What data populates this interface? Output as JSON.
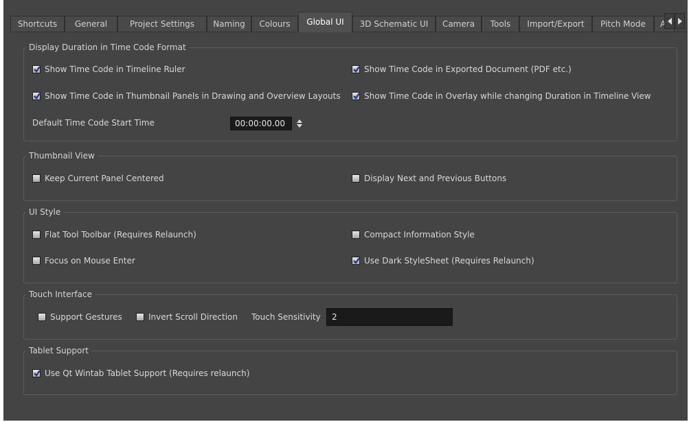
{
  "tabs": [
    {
      "label": "Shortcuts",
      "active": false
    },
    {
      "label": "General",
      "active": false
    },
    {
      "label": "Project Settings",
      "active": false
    },
    {
      "label": "Naming",
      "active": false
    },
    {
      "label": "Colours",
      "active": false
    },
    {
      "label": "Global UI",
      "active": true
    },
    {
      "label": "3D Schematic UI",
      "active": false
    },
    {
      "label": "Camera",
      "active": false
    },
    {
      "label": "Tools",
      "active": false
    },
    {
      "label": "Import/Export",
      "active": false
    },
    {
      "label": "Pitch Mode",
      "active": false
    },
    {
      "label": "Ad",
      "active": false
    }
  ],
  "tab_scroll": {
    "left_icon": "arrow-left-icon",
    "right_icon": "arrow-right-icon"
  },
  "timecode_group": {
    "title": "Display Duration in Time Code Format",
    "timeline_ruler": {
      "label": "Show Time Code in Timeline Ruler",
      "checked": true
    },
    "exported_document": {
      "label": "Show Time Code in Exported Document (PDF etc.)",
      "checked": true
    },
    "thumbnail_panels": {
      "label": "Show Time Code in Thumbnail Panels in Drawing and Overview Layouts",
      "checked": true
    },
    "overlay": {
      "label": "Show Time Code in Overlay while changing Duration in Timeline View",
      "checked": true
    },
    "start_time_label": "Default Time Code Start Time",
    "start_time_value": "00:00:00.00"
  },
  "thumbnail_group": {
    "title": "Thumbnail View",
    "keep_centered": {
      "label": "Keep Current Panel Centered",
      "checked": false
    },
    "next_prev": {
      "label": "Display Next and Previous Buttons",
      "checked": false
    }
  },
  "ui_style_group": {
    "title": "UI Style",
    "flat_toolbar": {
      "label": "Flat Tool Toolbar (Requires Relaunch)",
      "checked": false
    },
    "compact_info": {
      "label": "Compact Information Style",
      "checked": false
    },
    "focus_mouse": {
      "label": "Focus on Mouse Enter",
      "checked": false
    },
    "dark_stylesheet": {
      "label": "Use Dark StyleSheet (Requires Relaunch)",
      "checked": true
    }
  },
  "touch_group": {
    "title": "Touch Interface",
    "support_gestures": {
      "label": "Support Gestures",
      "checked": false
    },
    "invert_scroll": {
      "label": "Invert Scroll Direction",
      "checked": false
    },
    "sensitivity_label": "Touch Sensitivity",
    "sensitivity_value": "2"
  },
  "tablet_group": {
    "title": "Tablet Support",
    "wintab": {
      "label": "Use Qt Wintab Tablet Support (Requires relaunch)",
      "checked": true
    }
  },
  "colors": {
    "panel_bg": "#444444",
    "field_bg": "#1a1a1a",
    "check": "#2a3a8a"
  }
}
